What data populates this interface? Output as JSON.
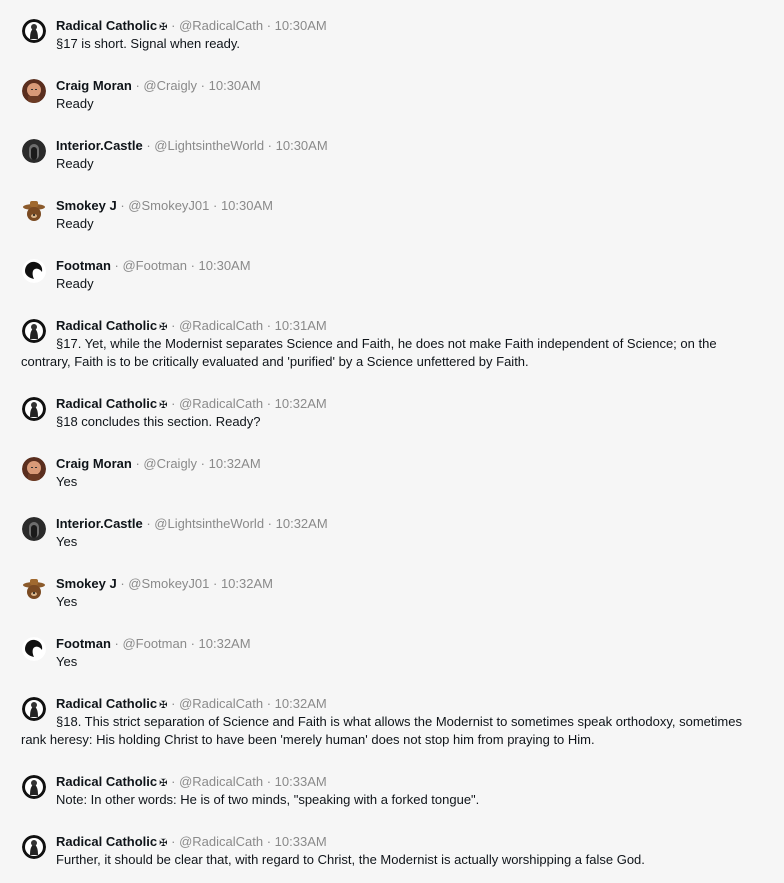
{
  "messages": [
    {
      "name": "Radical Catholic",
      "badge": "✠",
      "handle": "@RadicalCath",
      "time": "10:30AM",
      "text": "§17 is short. Signal when ready.",
      "avatar": "radical"
    },
    {
      "name": "Craig Moran",
      "badge": "",
      "handle": "@Craigly",
      "time": "10:30AM",
      "text": "Ready",
      "avatar": "craig"
    },
    {
      "name": "Interior.Castle",
      "badge": "",
      "handle": "@LightsintheWorld",
      "time": "10:30AM",
      "text": "Ready",
      "avatar": "interior"
    },
    {
      "name": "Smokey J",
      "badge": "",
      "handle": "@SmokeyJ01",
      "time": "10:30AM",
      "text": "Ready",
      "avatar": "smokey"
    },
    {
      "name": "Footman",
      "badge": "",
      "handle": "@Footman",
      "time": "10:30AM",
      "text": "Ready",
      "avatar": "footman"
    },
    {
      "name": "Radical Catholic",
      "badge": "✠",
      "handle": "@RadicalCath",
      "time": "10:31AM",
      "text": "§17. Yet, while the Modernist separates Science and Faith, he does not make Faith independent of Science; on the contrary, Faith is to be critically evaluated and 'purified' by a Science unfettered by Faith.",
      "avatar": "radical"
    },
    {
      "name": "Radical Catholic",
      "badge": "✠",
      "handle": "@RadicalCath",
      "time": "10:32AM",
      "text": "§18 concludes this section. Ready?",
      "avatar": "radical"
    },
    {
      "name": "Craig Moran",
      "badge": "",
      "handle": "@Craigly",
      "time": "10:32AM",
      "text": "Yes",
      "avatar": "craig"
    },
    {
      "name": "Interior.Castle",
      "badge": "",
      "handle": "@LightsintheWorld",
      "time": "10:32AM",
      "text": "Yes",
      "avatar": "interior"
    },
    {
      "name": "Smokey J",
      "badge": "",
      "handle": "@SmokeyJ01",
      "time": "10:32AM",
      "text": "Yes",
      "avatar": "smokey"
    },
    {
      "name": "Footman",
      "badge": "",
      "handle": "@Footman",
      "time": "10:32AM",
      "text": "Yes",
      "avatar": "footman"
    },
    {
      "name": "Radical Catholic",
      "badge": "✠",
      "handle": "@RadicalCath",
      "time": "10:32AM",
      "text": "§18. This strict separation of Science and Faith is what allows the Modernist to sometimes speak orthodoxy, sometimes rank heresy: His holding Christ to have been 'merely human' does not stop him from praying to Him.",
      "avatar": "radical"
    },
    {
      "name": "Radical Catholic",
      "badge": "✠",
      "handle": "@RadicalCath",
      "time": "10:33AM",
      "text": "Note: In other words: He is of two minds, \"speaking with a forked tongue\".",
      "avatar": "radical"
    },
    {
      "name": "Radical Catholic",
      "badge": "✠",
      "handle": "@RadicalCath",
      "time": "10:33AM",
      "text": "Further, it should be clear that, with regard to Christ, the Modernist is actually worshipping a false God.",
      "avatar": "radical"
    }
  ]
}
